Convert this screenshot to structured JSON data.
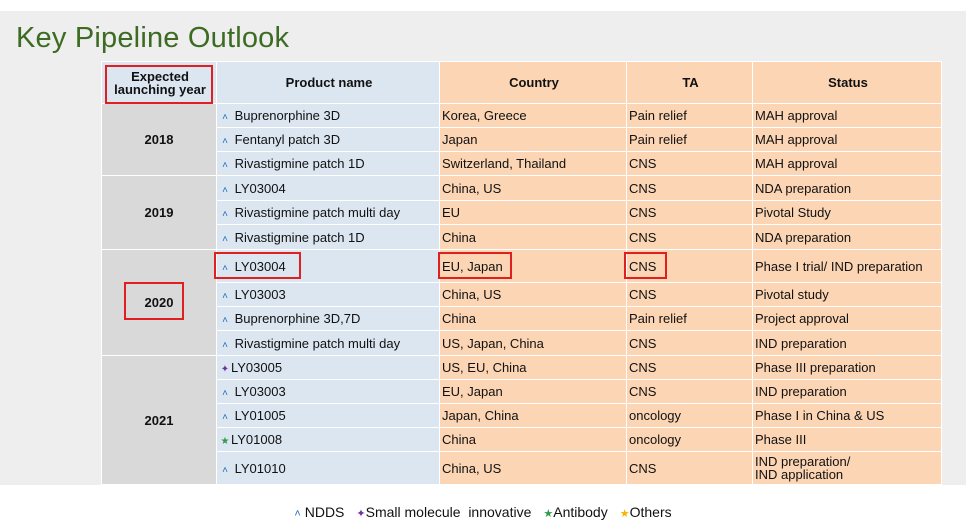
{
  "title": "Key Pipeline Outlook",
  "headers": {
    "year": "Expected launching year",
    "product": "Product name",
    "country": "Country",
    "ta": "TA",
    "status": "Status"
  },
  "groups": [
    {
      "year": "2018",
      "rows": [
        {
          "type": "NDDS",
          "product": "Buprenorphine 3D",
          "country": "Korea, Greece",
          "ta": "Pain relief",
          "status": "MAH approval"
        },
        {
          "type": "NDDS",
          "product": "Fentanyl patch 3D",
          "country": "Japan",
          "ta": "Pain relief",
          "status": "MAH approval"
        },
        {
          "type": "NDDS",
          "product": "Rivastigmine patch 1D",
          "country": "Switzerland, Thailand",
          "ta": "CNS",
          "status": "MAH approval"
        }
      ]
    },
    {
      "year": "2019",
      "rows": [
        {
          "type": "NDDS",
          "product": "LY03004",
          "country": "China, US",
          "ta": "CNS",
          "status": "NDA preparation"
        },
        {
          "type": "NDDS",
          "product": "Rivastigmine patch multi day",
          "country": "EU",
          "ta": "CNS",
          "status": "Pivotal Study"
        },
        {
          "type": "NDDS",
          "product": "Rivastigmine patch 1D",
          "country": "China",
          "ta": "CNS",
          "status": "NDA preparation"
        }
      ]
    },
    {
      "year": "2020",
      "rows": [
        {
          "type": "NDDS",
          "product": "LY03004",
          "country": "EU, Japan",
          "ta": "CNS",
          "status": "Phase I trial/ IND preparation"
        },
        {
          "type": "NDDS",
          "product": "LY03003",
          "country": "China, US",
          "ta": "CNS",
          "status": "Pivotal study"
        },
        {
          "type": "NDDS",
          "product": "Buprenorphine 3D,7D",
          "country": "China",
          "ta": "Pain relief",
          "status": "Project approval"
        },
        {
          "type": "NDDS",
          "product": "Rivastigmine patch multi day",
          "country": "US, Japan, China",
          "ta": "CNS",
          "status": "IND preparation"
        }
      ]
    },
    {
      "year": "2021",
      "rows": [
        {
          "type": "Small molecule innovative",
          "product": "LY03005",
          "country": "US, EU, China",
          "ta": "CNS",
          "status": "Phase III preparation"
        },
        {
          "type": "NDDS",
          "product": "LY03003",
          "country": "EU, Japan",
          "ta": "CNS",
          "status": "IND preparation"
        },
        {
          "type": "NDDS",
          "product": "LY01005",
          "country": "Japan, China",
          "ta": "oncology",
          "status": "Phase I in China & US"
        },
        {
          "type": "Antibody",
          "product": "LY01008",
          "country": "China",
          "ta": "oncology",
          "status": "Phase III"
        },
        {
          "type": "NDDS",
          "product": "LY01010",
          "country": "China, US",
          "ta": "CNS",
          "status": "IND preparation/\nIND application"
        }
      ]
    }
  ],
  "legend": [
    {
      "label": "NDDS",
      "symbol": "˄",
      "color": "#1f6fc0"
    },
    {
      "label": "Small molecule  innovative",
      "symbol": "✦",
      "color": "#7030a0"
    },
    {
      "label": "Antibody",
      "symbol": "★",
      "color": "#2e9c48"
    },
    {
      "label": "Others",
      "symbol": "★",
      "color": "#f2b500"
    }
  ],
  "symbols": {
    "NDDS": {
      "glyph": "˄",
      "color": "#1f6fc0"
    },
    "Small molecule innovative": {
      "glyph": "✦",
      "color": "#7030a0"
    },
    "Antibody": {
      "glyph": "★",
      "color": "#2e9c48"
    },
    "Others": {
      "glyph": "★",
      "color": "#f2b500"
    }
  },
  "highlight_color": "#e02020"
}
